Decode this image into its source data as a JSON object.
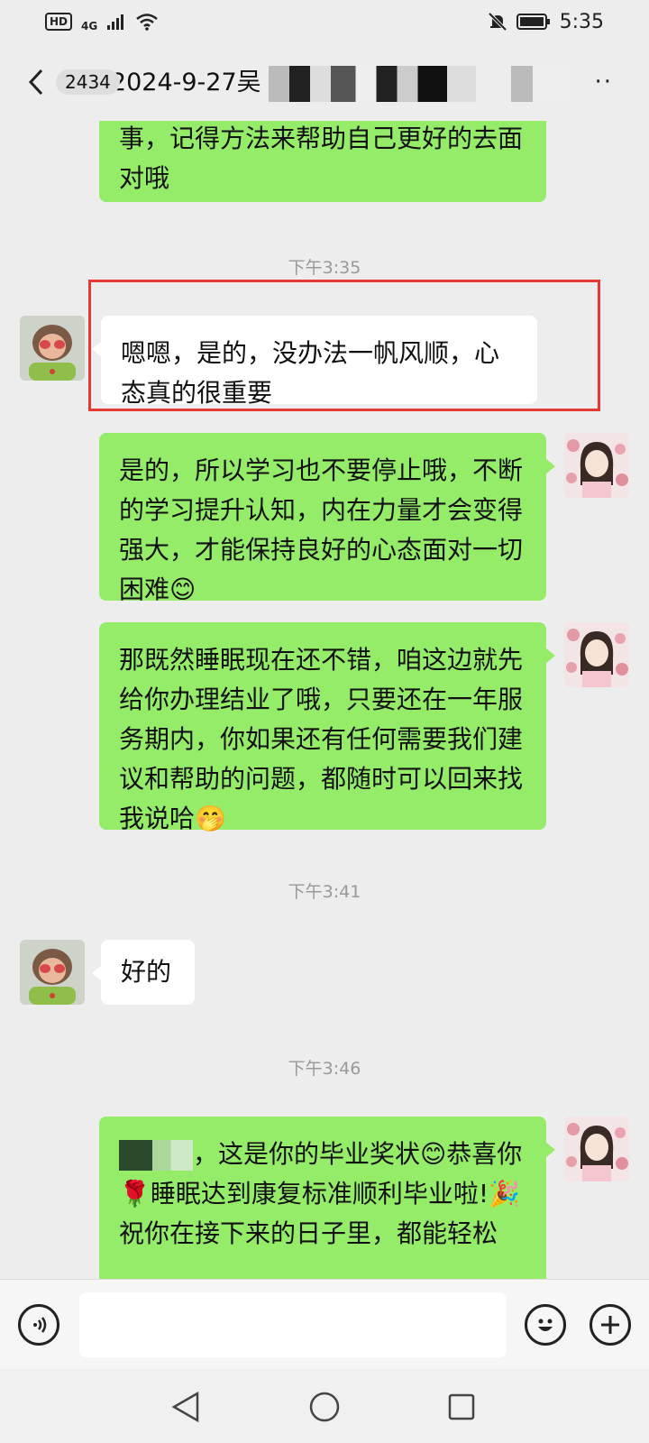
{
  "status_bar": {
    "hd": "HD",
    "network": "4G",
    "time": "5:35"
  },
  "header": {
    "unread_count": "2434",
    "title": "2024-9-27吴"
  },
  "messages": {
    "m1_text": "事，记得方法来帮助自己更好的去面对哦",
    "ts1": "下午3:35",
    "m2_text": "嗯嗯，是的，没办法一帆风顺，心态真的很重要",
    "m3_text": "是的，所以学习也不要停止哦，不断的学习提升认知，内在力量才会变得强大，才能保持良好的心态面对一切困难",
    "m3_emoji": "😊",
    "m4_text": "那既然睡眠现在还不错，咱这边就先给你办理结业了哦，只要还在一年服务期内，你如果还有任何需要我们建议和帮助的问题，都随时可以回来找我说哈",
    "m4_emoji": "🤭",
    "ts2": "下午3:41",
    "m5_text": "好的",
    "ts3": "下午3:46",
    "m6_part1": "，这是你的毕业奖状",
    "m6_emoji1": "😊",
    "m6_part2": "恭喜你",
    "m6_emoji2": "🌹",
    "m6_part3": "睡眠达到康复标准顺利毕业啦!",
    "m6_emoji3": "🎉",
    "m6_part4": "祝你在接下来的日子里，都能轻松"
  },
  "icons": {
    "back": "chevron-left-icon",
    "more": "more-icon",
    "voice": "voice-icon",
    "emoji": "emoji-icon",
    "add": "add-icon"
  },
  "colors": {
    "bubble_self": "#95ec69",
    "bubble_other": "#ffffff",
    "background": "#ededed",
    "highlight": "#e53935"
  }
}
